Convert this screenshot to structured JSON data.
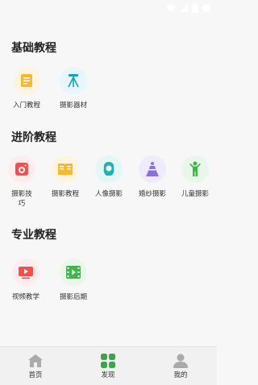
{
  "sections": [
    {
      "title": "基础教程",
      "items": [
        {
          "label": "入门教程",
          "icon": "document-icon",
          "bg": "#fff4e0",
          "fg": "#f5b82e"
        },
        {
          "label": "摄影器材",
          "icon": "tripod-icon",
          "bg": "#e6f6fb",
          "fg": "#1a9fbf"
        }
      ]
    },
    {
      "title": "进阶教程",
      "items": [
        {
          "label": "摄影技巧",
          "icon": "camera-icon",
          "bg": "#ffecec",
          "fg": "#f05050"
        },
        {
          "label": "摄影教程",
          "icon": "book-icon",
          "bg": "#fff4e0",
          "fg": "#f5b82e"
        },
        {
          "label": "人像摄影",
          "icon": "portrait-icon",
          "bg": "#e4f7f7",
          "fg": "#1bb3b3"
        },
        {
          "label": "婚纱摄影",
          "icon": "wedding-dress-icon",
          "bg": "#efeafc",
          "fg": "#8a6fe0"
        },
        {
          "label": "儿童摄影",
          "icon": "child-icon",
          "bg": "#e9f7ea",
          "fg": "#3fb64a"
        }
      ]
    },
    {
      "title": "专业教程",
      "items": [
        {
          "label": "视频教学",
          "icon": "video-play-icon",
          "bg": "#ffecec",
          "fg": "#f05050"
        },
        {
          "label": "摄影后期",
          "icon": "film-strip-icon",
          "bg": "#e9f7ea",
          "fg": "#3fb64a"
        }
      ]
    }
  ],
  "tabbar": {
    "tabs": [
      {
        "label": "首页",
        "icon": "home-icon",
        "active": false
      },
      {
        "label": "发现",
        "icon": "grid-icon",
        "active": true
      },
      {
        "label": "我的",
        "icon": "user-icon",
        "active": false
      }
    ],
    "active_color": "#3fa34d",
    "inactive_color": "#aaaaaa"
  }
}
